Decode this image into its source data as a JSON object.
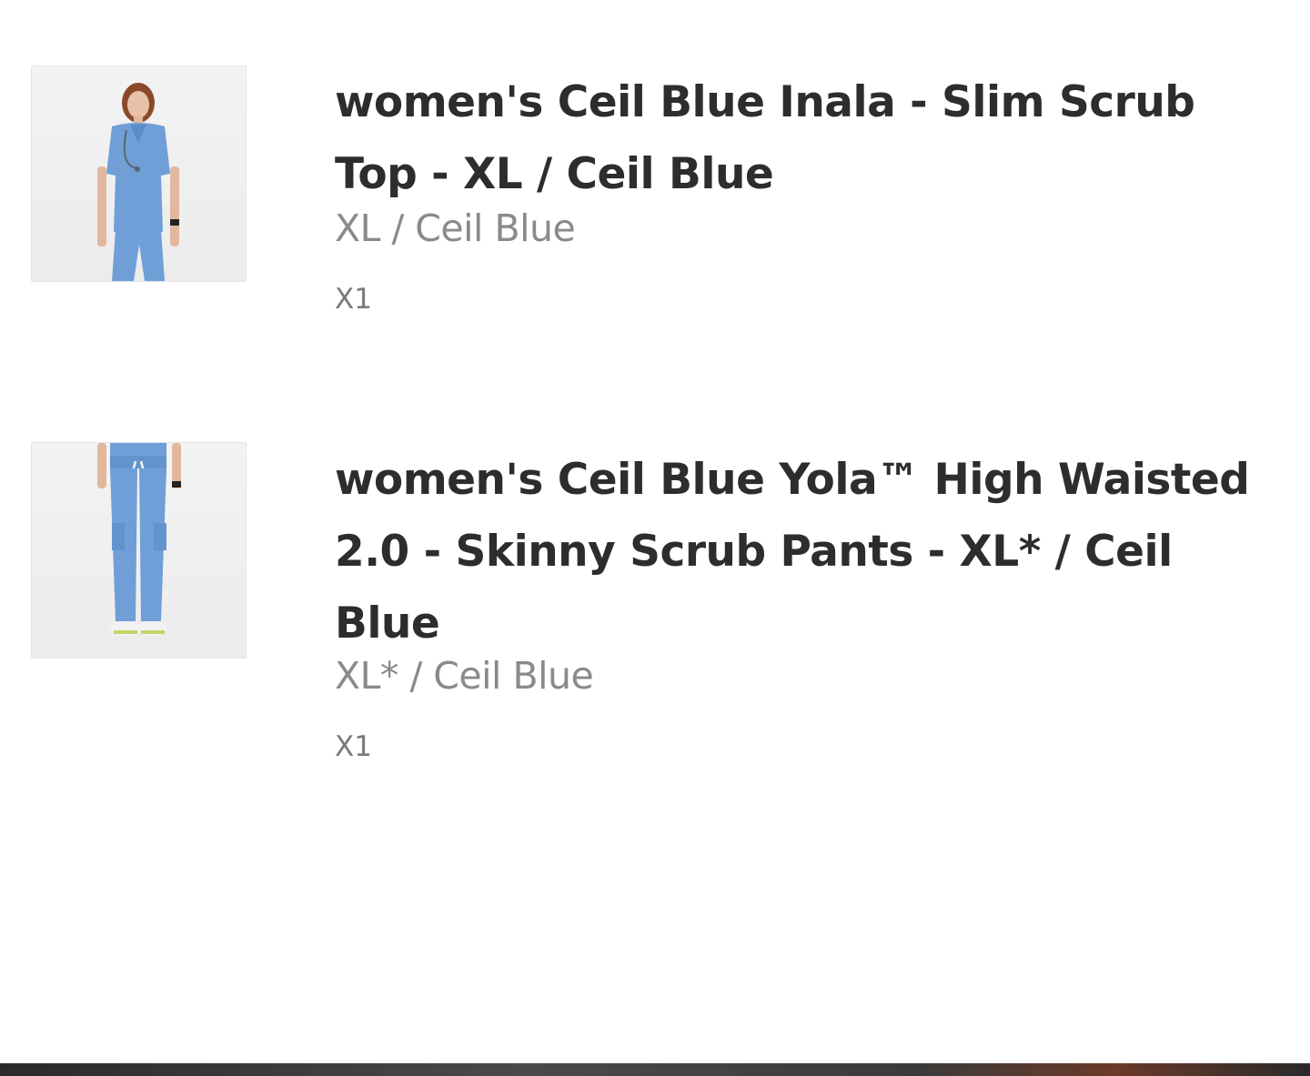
{
  "cart": {
    "items": [
      {
        "title": "women's Ceil Blue Inala - Slim Scrub Top - XL / Ceil Blue",
        "variant": "XL / Ceil Blue",
        "quantity": "X1",
        "image_icon": "scrub-top-product-image"
      },
      {
        "title": "women's Ceil Blue Yola™ High Waisted 2.0 - Skinny Scrub Pants - XL* / Ceil Blue",
        "variant": "XL* / Ceil Blue",
        "quantity": "X1",
        "image_icon": "scrub-pants-product-image"
      }
    ]
  },
  "colors": {
    "ceil_blue": "#6f9fd6",
    "title_text": "#2d2d2d",
    "variant_text": "#8a8a8a"
  }
}
